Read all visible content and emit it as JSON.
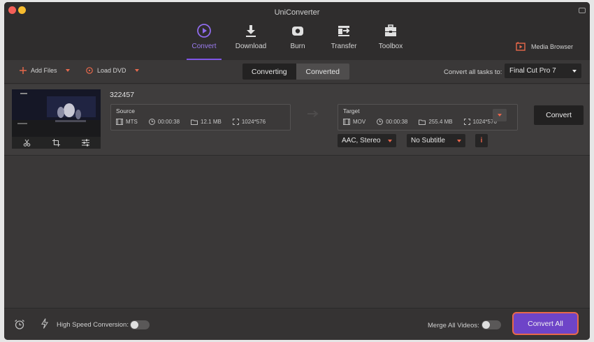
{
  "app": {
    "title": "UniConverter"
  },
  "tabs": [
    {
      "label": "Convert",
      "icon": "convert-icon",
      "active": true
    },
    {
      "label": "Download",
      "icon": "download-icon",
      "active": false
    },
    {
      "label": "Burn",
      "icon": "burn-icon",
      "active": false
    },
    {
      "label": "Transfer",
      "icon": "transfer-icon",
      "active": false
    },
    {
      "label": "Toolbox",
      "icon": "toolbox-icon",
      "active": false
    }
  ],
  "media_browser": {
    "label": "Media Browser",
    "icon": "media-browser-icon"
  },
  "toolbar": {
    "add_files": "Add Files",
    "load_dvd": "Load DVD",
    "segment": {
      "converting": "Converting",
      "converted": "Converted",
      "selected": "Converting"
    },
    "convert_all_tasks_label": "Convert all tasks to:",
    "convert_all_tasks_value": "Final Cut Pro 7"
  },
  "file": {
    "name": "322457",
    "source": {
      "title": "Source",
      "format": "MTS",
      "duration": "00:00:38",
      "size": "12.1 MB",
      "resolution": "1024*576"
    },
    "target": {
      "title": "Target",
      "format": "MOV",
      "duration": "00:00:38",
      "size": "255.4 MB",
      "resolution": "1024*576"
    },
    "audio": "AAC, Stereo",
    "subtitle": "No Subtitle",
    "info_label": "i",
    "convert_label": "Convert"
  },
  "bottom": {
    "high_speed_label": "High Speed Conversion:",
    "high_speed_on": false,
    "merge_label": "Merge All Videos:",
    "merge_on": false,
    "convert_all_label": "Convert All"
  },
  "colors": {
    "accent": "#7f55e6",
    "orange": "#e8684a",
    "convert_all_bg": "#6e44c8"
  }
}
